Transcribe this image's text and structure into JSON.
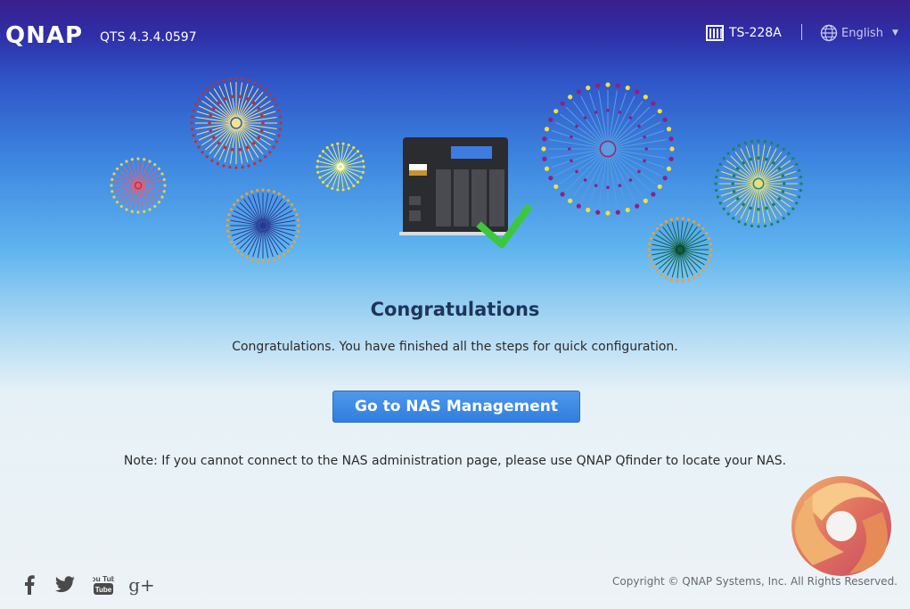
{
  "header": {
    "logo": "QNAP",
    "version": "QTS 4.3.4.0597",
    "model": "TS-228A",
    "language": "English"
  },
  "main": {
    "title": "Congratulations",
    "message": "Congratulations. You have finished all the steps for quick configuration.",
    "button_label": "Go to NAS Management",
    "note": "Note: If you cannot connect to the NAS administration page, please use QNAP Qfinder to locate your NAS."
  },
  "footer": {
    "social": [
      "facebook-icon",
      "twitter-icon",
      "youtube-icon",
      "google-plus-icon"
    ],
    "youtube_label": "You Tube",
    "google_label": "g+",
    "copyright": "Copyright © QNAP Systems, Inc. All Rights Reserved."
  },
  "colors": {
    "button": "#3a87e6",
    "title": "#1c3658",
    "check": "#3cc83c"
  }
}
